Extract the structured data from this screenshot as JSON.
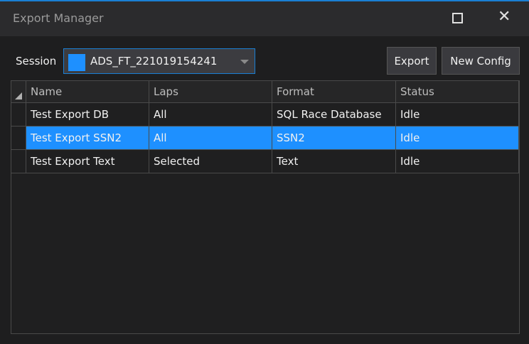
{
  "window": {
    "title": "Export Manager"
  },
  "session": {
    "label": "Session",
    "value": "ADS_FT_221019154241",
    "swatch_color": "#1e90ff"
  },
  "toolbar": {
    "export_label": "Export",
    "new_config_label": "New Config"
  },
  "table": {
    "columns": [
      "Name",
      "Laps",
      "Format",
      "Status"
    ],
    "rows": [
      {
        "name": "Test Export DB",
        "laps": "All",
        "format": "SQL Race Database",
        "status": "Idle",
        "selected": false
      },
      {
        "name": "Test Export SSN2",
        "laps": "All",
        "format": "SSN2",
        "status": "Idle",
        "selected": true
      },
      {
        "name": "Test Export Text",
        "laps": "Selected",
        "format": "Text",
        "status": "Idle",
        "selected": false
      }
    ]
  }
}
